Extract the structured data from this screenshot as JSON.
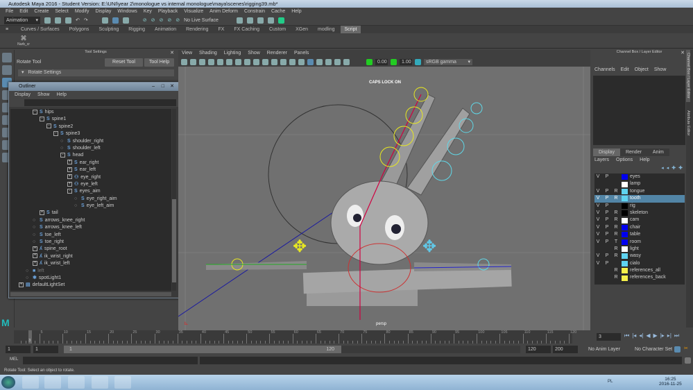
{
  "window": {
    "title": "Autodesk Maya 2016 - Student Version: E:\\UNI\\year 2\\monologue vs internal monologue\\maya\\scenes\\rigging39.mb*"
  },
  "menubar": [
    "File",
    "Edit",
    "Create",
    "Select",
    "Modify",
    "Display",
    "Windows",
    "Key",
    "Playback",
    "Visualize",
    "Anim Deform",
    "Constrain",
    "Cache",
    "Help"
  ],
  "statusline": {
    "menuset": "Animation",
    "live_surface": "No Live Surface"
  },
  "shelf": {
    "tabs": [
      "Curves / Surfaces",
      "Polygons",
      "Sculpting",
      "Rigging",
      "Animation",
      "Rendering",
      "FX",
      "FX Caching",
      "Custom",
      "XGen",
      "modling",
      "Script"
    ],
    "active": "Script",
    "items": [
      {
        "label": "Nurb_cr"
      }
    ]
  },
  "tool_settings": {
    "panel_title": "Tool Settings",
    "tool_name": "Rotate Tool",
    "reset_label": "Reset Tool",
    "help_label": "Tool Help",
    "section": "Rotate Settings"
  },
  "outliner": {
    "title": "Outliner",
    "menu": [
      "Display",
      "Show",
      "Help"
    ],
    "items": [
      {
        "label": "hips",
        "depth": 1,
        "exp": "-",
        "icon": "joint"
      },
      {
        "label": "spine1",
        "depth": 2,
        "exp": "-",
        "icon": "joint"
      },
      {
        "label": "spine2",
        "depth": 3,
        "exp": "-",
        "icon": "joint"
      },
      {
        "label": "spine3",
        "depth": 4,
        "exp": "-",
        "icon": "joint"
      },
      {
        "label": "shoulder_right",
        "depth": 5,
        "exp": "",
        "icon": "joint"
      },
      {
        "label": "shoulder_left",
        "depth": 5,
        "exp": "",
        "icon": "joint"
      },
      {
        "label": "head",
        "depth": 5,
        "exp": "-",
        "icon": "joint"
      },
      {
        "label": "ear_right",
        "depth": 6,
        "exp": "+",
        "icon": "joint"
      },
      {
        "label": "ear_left",
        "depth": 6,
        "exp": "+",
        "icon": "joint"
      },
      {
        "label": "eye_right",
        "depth": 6,
        "exp": "+",
        "icon": "eye"
      },
      {
        "label": "eye_left",
        "depth": 6,
        "exp": "+",
        "icon": "eye"
      },
      {
        "label": "eyes_aim",
        "depth": 6,
        "exp": "-",
        "icon": "joint"
      },
      {
        "label": "eye_right_aim",
        "depth": 7,
        "exp": "",
        "icon": "joint"
      },
      {
        "label": "eye_left_aim",
        "depth": 7,
        "exp": "",
        "icon": "joint"
      },
      {
        "label": "tail",
        "depth": 2,
        "exp": "+",
        "icon": "joint"
      },
      {
        "label": "arrows_knee_right",
        "depth": 1,
        "exp": "",
        "icon": "joint"
      },
      {
        "label": "arrows_knee_left",
        "depth": 1,
        "exp": "",
        "icon": "joint"
      },
      {
        "label": "toe_left",
        "depth": 1,
        "exp": "",
        "icon": "joint"
      },
      {
        "label": "toe_right",
        "depth": 1,
        "exp": "",
        "icon": "joint"
      },
      {
        "label": "spine_root",
        "depth": 1,
        "exp": "+",
        "icon": "ik"
      },
      {
        "label": "ik_wrist_right",
        "depth": 1,
        "exp": "+",
        "icon": "ik"
      },
      {
        "label": "ik_wrist_left",
        "depth": 1,
        "exp": "+",
        "icon": "ik"
      },
      {
        "label": "left",
        "depth": 0,
        "exp": "",
        "icon": "camera"
      },
      {
        "label": "spotLight1",
        "depth": 0,
        "exp": "",
        "icon": "light"
      },
      {
        "label": "defaultLightSet",
        "depth": -1,
        "exp": "+",
        "icon": "set"
      }
    ]
  },
  "viewport": {
    "menu": [
      "View",
      "Shading",
      "Lighting",
      "Show",
      "Renderer",
      "Panels"
    ],
    "exposure": "0.00",
    "gamma": "1.00",
    "color_space": "sRGB gamma",
    "caps_lock": "CAPS LOCK ON",
    "camera": "persp"
  },
  "channel_box": {
    "title": "Channel Box / Layer Editor",
    "menu": [
      "Channels",
      "Edit",
      "Object",
      "Show"
    ],
    "side_tabs": [
      "Channel Box / Layer Editor",
      "Attribute Editor"
    ]
  },
  "layer_editor": {
    "tabs": [
      "Display",
      "Render",
      "Anim"
    ],
    "active_tab": "Display",
    "menu": [
      "Layers",
      "Options",
      "Help"
    ],
    "layers": [
      {
        "v": "V",
        "p": "P",
        "r": "",
        "name": "eyes",
        "color": "#0000ee"
      },
      {
        "v": "",
        "p": "",
        "r": "",
        "name": "lamp",
        "color": "#ffffff"
      },
      {
        "v": "V",
        "p": "P",
        "r": "R",
        "name": "tongue",
        "color": "#5fd3f0"
      },
      {
        "v": "V",
        "p": "P",
        "r": "R",
        "name": "tooth",
        "color": "#5fd3f0",
        "selected": true
      },
      {
        "v": "V",
        "p": "P",
        "r": "",
        "name": "rig",
        "color": "#000000"
      },
      {
        "v": "V",
        "p": "P",
        "r": "R",
        "name": "skeleton",
        "color": "#000000"
      },
      {
        "v": "V",
        "p": "P",
        "r": "R",
        "name": "cam",
        "color": "#ffffff"
      },
      {
        "v": "V",
        "p": "P",
        "r": "R",
        "name": "chair",
        "color": "#0000ee"
      },
      {
        "v": "V",
        "p": "P",
        "r": "R",
        "name": "table",
        "color": "#0000ee"
      },
      {
        "v": "V",
        "p": "P",
        "r": "T",
        "name": "room",
        "color": "#0000ee"
      },
      {
        "v": "",
        "p": "",
        "r": "R",
        "name": "light",
        "color": "#ffffff"
      },
      {
        "v": "V",
        "p": "P",
        "r": "R",
        "name": "wasy",
        "color": "#5fd3f0"
      },
      {
        "v": "V",
        "p": "P",
        "r": "",
        "name": "cialo",
        "color": "#5fd3f0"
      },
      {
        "v": "",
        "p": "",
        "r": "R",
        "name": "references_all",
        "color": "#f5f04a"
      },
      {
        "v": "",
        "p": "",
        "r": "R",
        "name": "references_back",
        "color": "#f5f04a"
      }
    ]
  },
  "time_slider": {
    "ticks": [
      "5",
      "10",
      "15",
      "20",
      "25",
      "30",
      "35",
      "40",
      "45",
      "50",
      "55",
      "60",
      "65",
      "70",
      "75",
      "80",
      "85",
      "90",
      "95",
      "100",
      "105",
      "110",
      "115",
      "120"
    ],
    "current_frame": "3",
    "current_field": "3",
    "min": 1,
    "max": 120
  },
  "range_slider": {
    "start": "1",
    "start_inner": "1",
    "range_start": "1",
    "range_end": "120",
    "end_inner": "120",
    "end": "200",
    "anim_layer": "No Anim Layer",
    "character_set": "No Character Set"
  },
  "command_line": {
    "label": "MEL"
  },
  "help_line": {
    "text": "Rotate Tool: Select an object to rotate."
  },
  "taskbar": {
    "time": "16:25",
    "date": "2016-11-25",
    "lang": "PL"
  }
}
